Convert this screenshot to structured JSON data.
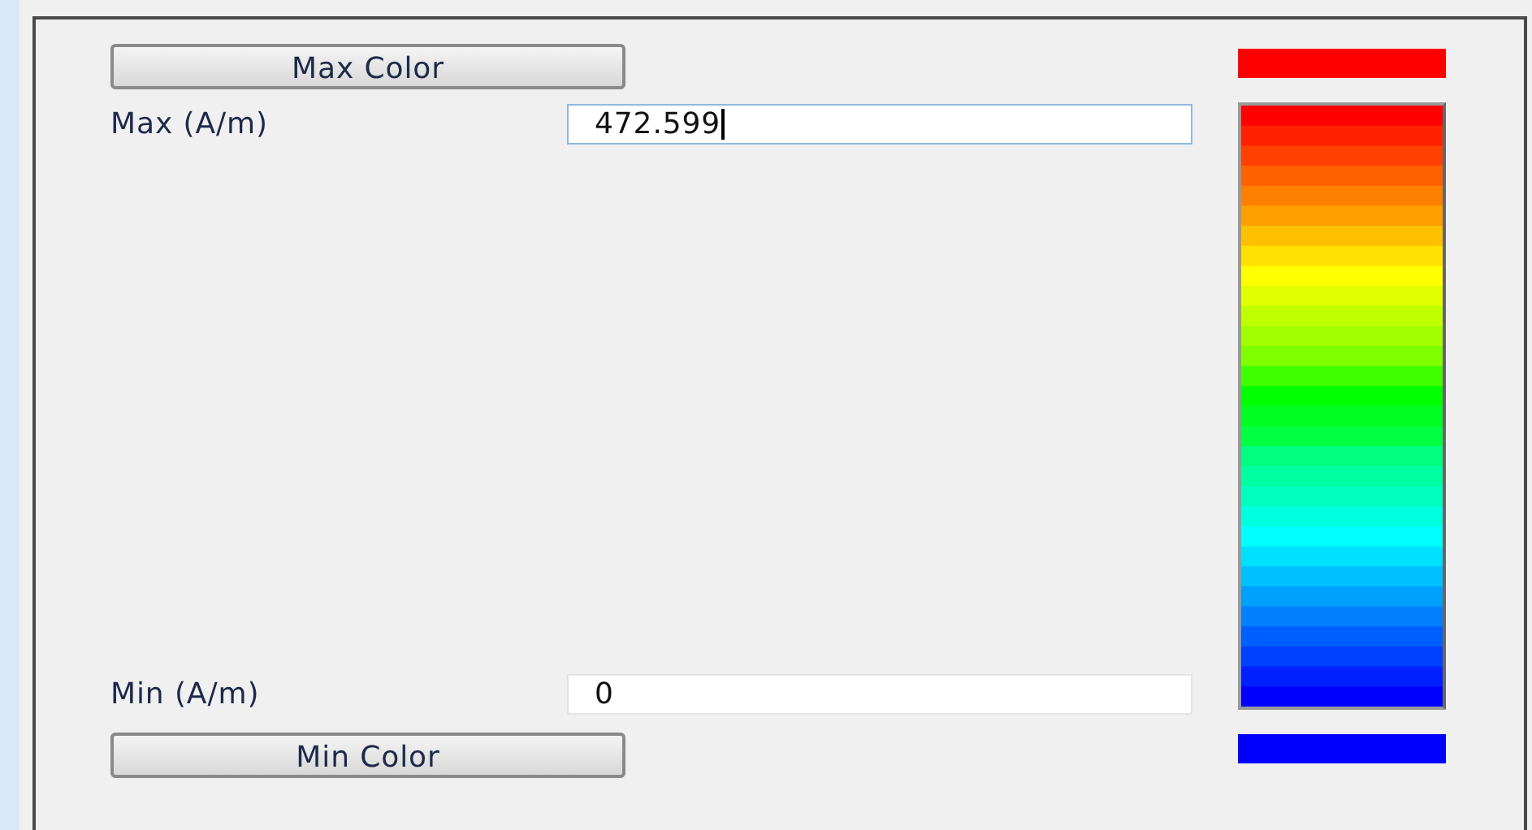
{
  "max": {
    "button": "Max Color",
    "color": "#ff0000",
    "label": "Max (A/m)",
    "value": "472.599",
    "focused": true
  },
  "min": {
    "button": "Min Color",
    "color": "#0000ff",
    "label": "Min (A/m)",
    "value": "0",
    "focused": false
  }
}
